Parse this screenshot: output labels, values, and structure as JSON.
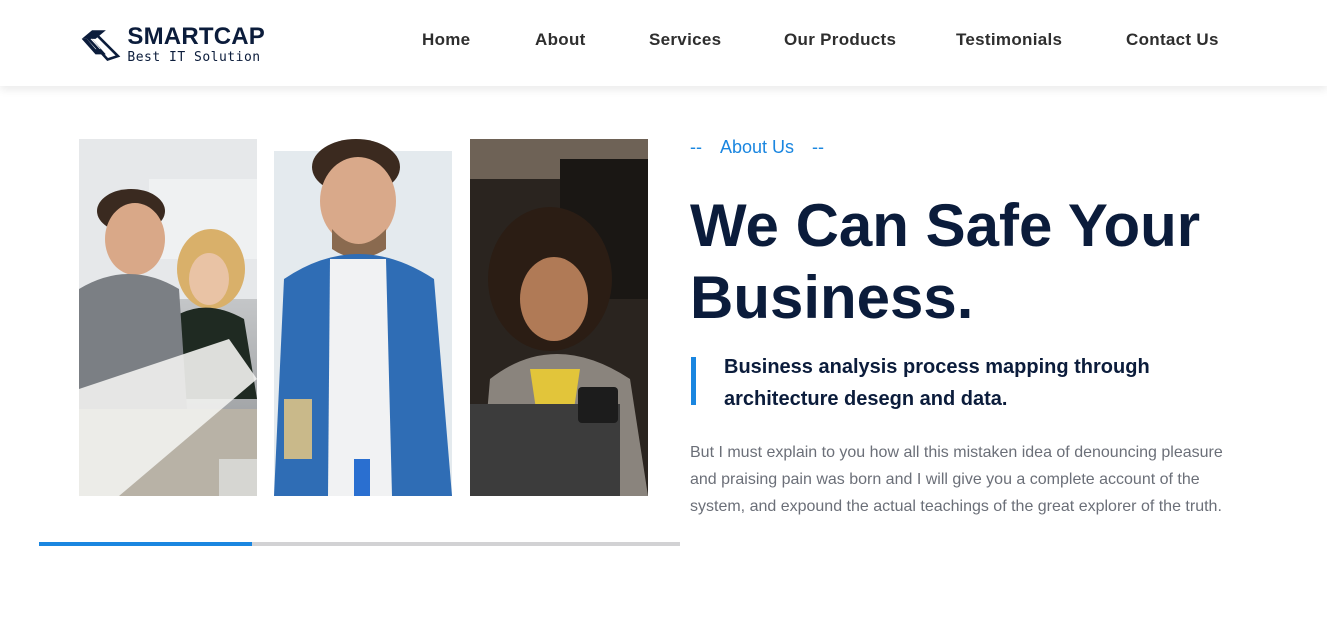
{
  "brand": {
    "name": "SMARTCAP",
    "tagline": "Best IT Solution",
    "color": "#0b1c3b"
  },
  "nav": {
    "items": [
      "Home",
      "About",
      "Services",
      "Our Products",
      "Testimonials",
      "Contact Us"
    ]
  },
  "about": {
    "eyebrow_dash_left": "--",
    "eyebrow": "About Us",
    "eyebrow_dash_right": "--",
    "headline_line1": "We Can Safe Your",
    "headline_line2": "Business.",
    "lead": "Business analysis process mapping through architecture desegn and data.",
    "body": "But I must explain to you how all this mistaken idea of denouncing pleasure and praising pain was born and I will give you a complete account of the system, and expound the actual teachings of the great explorer of the truth."
  },
  "gallery": {
    "images": [
      {
        "name": "team-meeting-photo"
      },
      {
        "name": "smiling-man-denim-shirt-photo"
      },
      {
        "name": "woman-with-phone-laptop-photo"
      }
    ],
    "slider_progress": 0.333
  },
  "colors": {
    "accent": "#1a86e0",
    "heading": "#0b1c3b",
    "body": "#6b6f78",
    "track": "#d2d2d4"
  }
}
